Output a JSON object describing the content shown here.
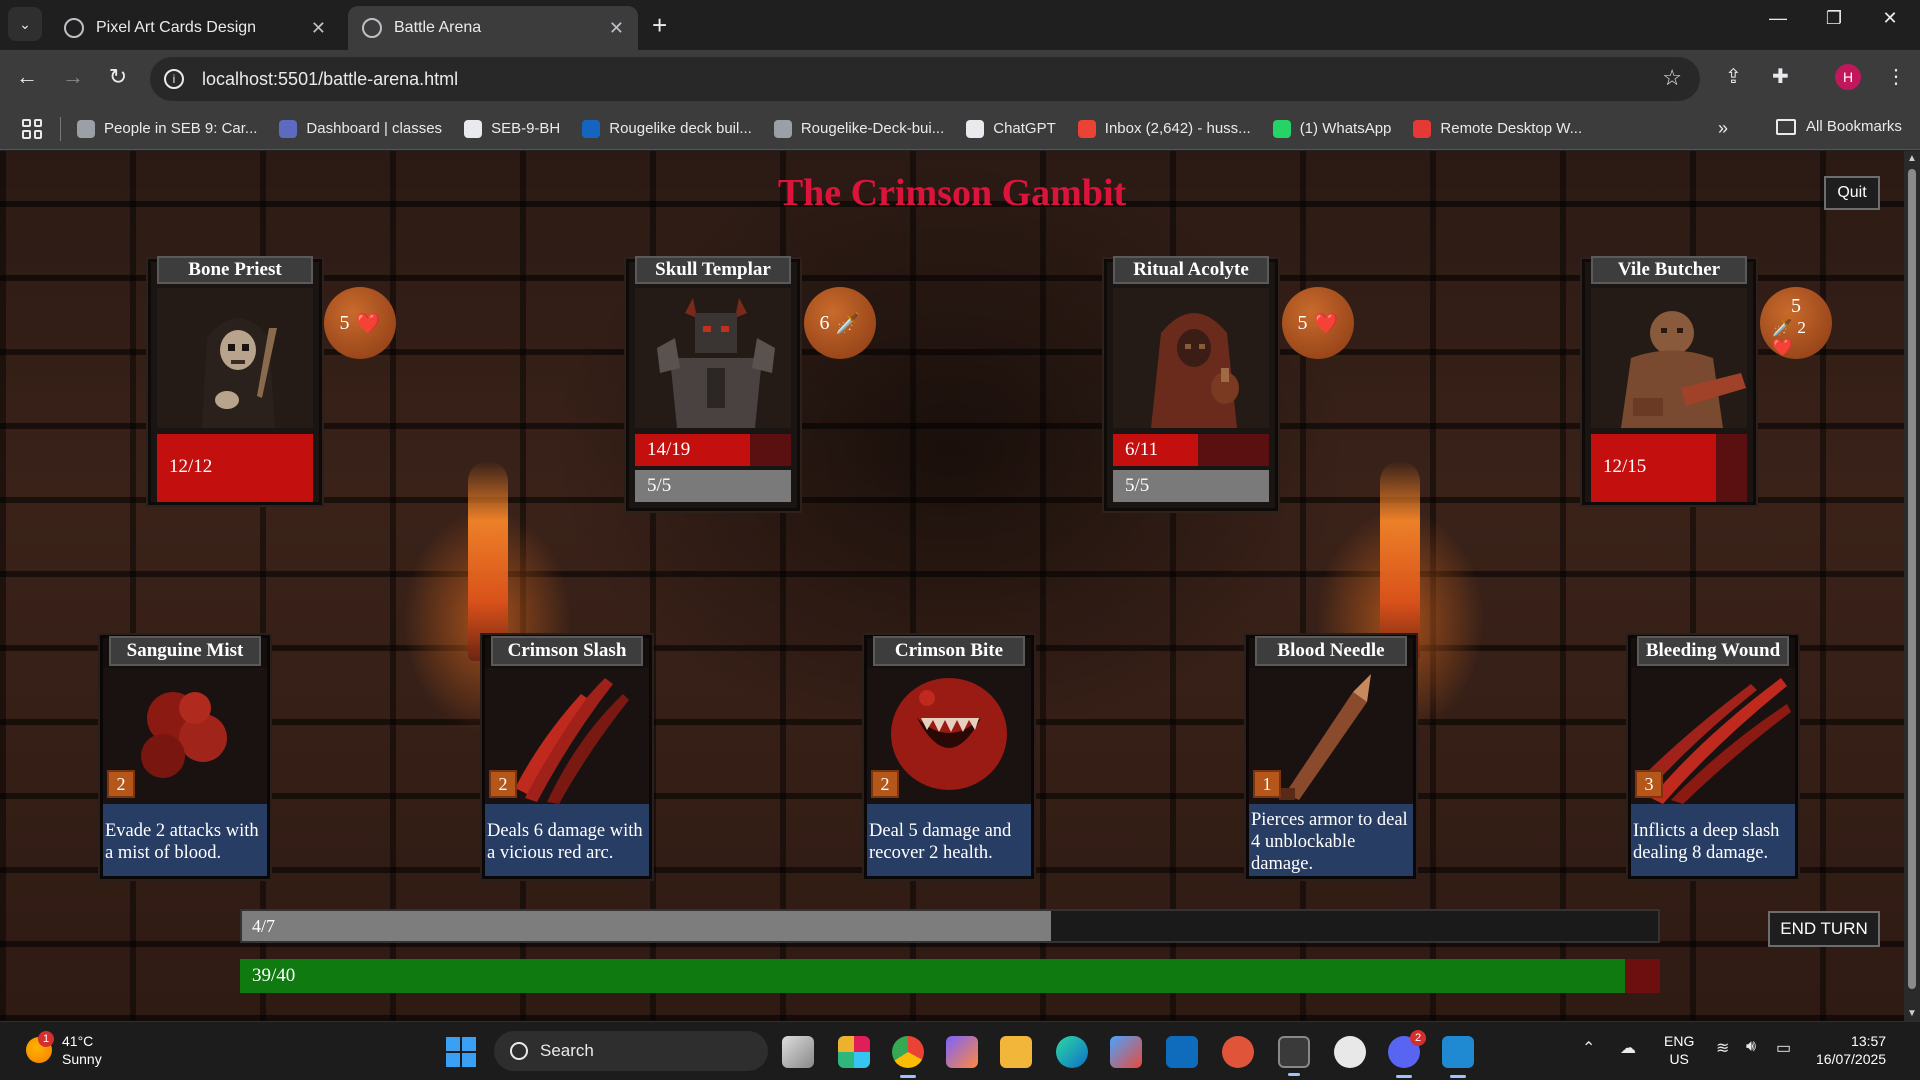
{
  "browser": {
    "tabs": [
      {
        "title": "Pixel Art Cards Design",
        "active": false
      },
      {
        "title": "Battle Arena",
        "active": true
      }
    ],
    "url": "localhost:5501/battle-arena.html",
    "profile_initial": "H",
    "bookmarks": [
      {
        "label": "People in SEB 9: Car...",
        "icon_color": "#9aa0a6"
      },
      {
        "label": "Dashboard | classes",
        "icon_color": "#5c6bc0"
      },
      {
        "label": "SEB-9-BH",
        "icon_color": "#e8eaed"
      },
      {
        "label": "Rougelike deck buil...",
        "icon_color": "#1565c0"
      },
      {
        "label": "Rougelike-Deck-bui...",
        "icon_color": "#9aa0a6"
      },
      {
        "label": "ChatGPT",
        "icon_color": "#e8eaed"
      },
      {
        "label": "Inbox (2,642) - huss...",
        "icon_color": "#ea4335"
      },
      {
        "label": "(1) WhatsApp",
        "icon_color": "#25d366"
      },
      {
        "label": "Remote Desktop W...",
        "icon_color": "#e53935"
      }
    ],
    "all_bookmarks_label": "All Bookmarks"
  },
  "game": {
    "title": "The Crimson Gambit",
    "quit_label": "Quit",
    "end_turn_label": "END TURN",
    "enemies": [
      {
        "name": "Bone Priest",
        "hp": "12/12",
        "hp_fraction": 1.0,
        "armor": null,
        "intent_text": "5",
        "intent_icon": "heart-icon",
        "intent_glyph": "❤️"
      },
      {
        "name": "Skull Templar",
        "hp": "14/19",
        "hp_fraction": 0.737,
        "armor": "5/5",
        "intent_text": "6",
        "intent_icon": "sword-icon",
        "intent_glyph": "🗡️"
      },
      {
        "name": "Ritual Acolyte",
        "hp": "6/11",
        "hp_fraction": 0.545,
        "armor": "5/5",
        "intent_text": "5",
        "intent_icon": "heart-icon",
        "intent_glyph": "❤️"
      },
      {
        "name": "Vile Butcher",
        "hp": "12/15",
        "hp_fraction": 0.8,
        "armor": null,
        "intent_text": "5",
        "intent_icon": "sword-heart-icon",
        "intent_glyph": "🗡️ 2 ❤️"
      }
    ],
    "hand": [
      {
        "name": "Sanguine Mist",
        "cost": "2",
        "description": "Evade 2 attacks with a mist of blood."
      },
      {
        "name": "Crimson Slash",
        "cost": "2",
        "description": "Deals 6 damage with a vicious red arc."
      },
      {
        "name": "Crimson Bite",
        "cost": "2",
        "description": "Deal 5 damage and recover 2 health."
      },
      {
        "name": "Blood Needle",
        "cost": "1",
        "description": "Pierces armor to deal 4 unblockable damage."
      },
      {
        "name": "Bleeding Wound",
        "cost": "3",
        "description": "Inflicts a deep slash dealing 8 damage."
      }
    ],
    "energy": {
      "text": "4/7",
      "fraction": 0.571
    },
    "player_hp": {
      "text": "39/40",
      "fraction": 0.975
    }
  },
  "taskbar": {
    "weather_temp": "41°C",
    "weather_desc": "Sunny",
    "weather_badge": "1",
    "search_label": "Search",
    "lang_line1": "ENG",
    "lang_line2": "US",
    "time": "13:57",
    "date": "16/07/2025",
    "discord_badge": "2"
  }
}
